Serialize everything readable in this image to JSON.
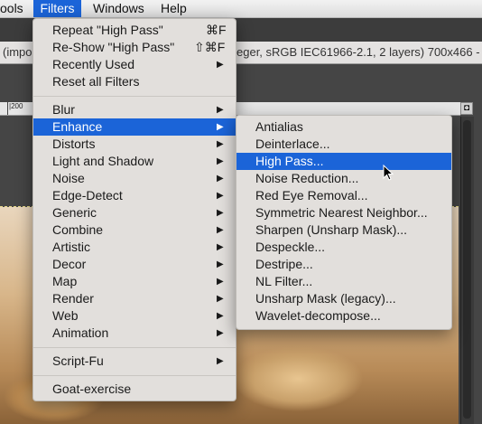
{
  "menubar": {
    "items": [
      "ools",
      "Filters",
      "Windows",
      "Help"
    ]
  },
  "titlebar": {
    "left_text": "(impo",
    "right_text": "eger, sRGB IEC61966-2.1, 2 layers) 700x466 -"
  },
  "ruler": {
    "label": "|200"
  },
  "filters_menu": {
    "top_items": [
      {
        "label": "Repeat \"High Pass\"",
        "shortcut": "⌘F"
      },
      {
        "label": "Re-Show \"High Pass\"",
        "shortcut": "⇧⌘F"
      },
      {
        "label": "Recently Used",
        "submenu": true
      },
      {
        "label": "Reset all Filters"
      }
    ],
    "groups": [
      {
        "label": "Blur"
      },
      {
        "label": "Enhance",
        "highlighted": true
      },
      {
        "label": "Distorts"
      },
      {
        "label": "Light and Shadow"
      },
      {
        "label": "Noise"
      },
      {
        "label": "Edge-Detect"
      },
      {
        "label": "Generic"
      },
      {
        "label": "Combine"
      },
      {
        "label": "Artistic"
      },
      {
        "label": "Decor"
      },
      {
        "label": "Map"
      },
      {
        "label": "Render"
      },
      {
        "label": "Web"
      },
      {
        "label": "Animation"
      }
    ],
    "script_fu": "Script-Fu",
    "goat": "Goat-exercise"
  },
  "enhance_menu": {
    "items": [
      "Antialias",
      "Deinterlace...",
      "High Pass...",
      "Noise Reduction...",
      "Red Eye Removal...",
      "Symmetric Nearest Neighbor...",
      "Sharpen (Unsharp Mask)...",
      "Despeckle...",
      "Destripe...",
      "NL Filter...",
      "Unsharp Mask (legacy)...",
      "Wavelet-decompose..."
    ],
    "highlighted_index": 2
  },
  "colors": {
    "highlight": "#1b64d8",
    "menu_bg": "#e2dfdc"
  }
}
